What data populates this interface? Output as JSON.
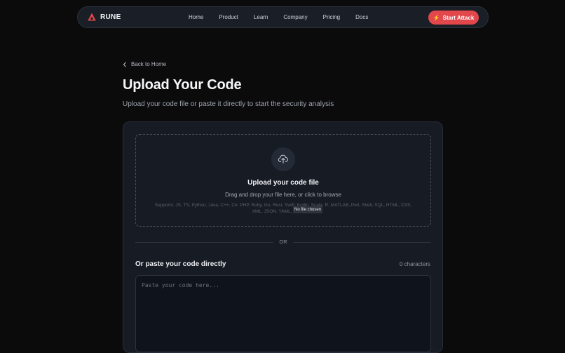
{
  "brand": {
    "name": "RUNE",
    "logo_icon": "triangle-logo-icon",
    "accent": "#e2474b"
  },
  "nav": {
    "links": [
      "Home",
      "Product",
      "Learn",
      "Company",
      "Pricing",
      "Docs"
    ],
    "cta_label": "Start Attack",
    "cta_icon": "lightning-icon"
  },
  "page": {
    "back_label": "Back to Home",
    "title": "Upload Your Code",
    "subtitle": "Upload your code file or paste it directly to start the security analysis"
  },
  "upload": {
    "icon": "cloud-upload-icon",
    "title": "Upload your code file",
    "description": "Drag and drop your file here, or click to browse",
    "supports": "Supports: JS, TS, Python, Java, C++, C#, PHP, Ruby, Go, Rust, Swift, Kotlin, Scala, R, MATLAB, Perl, Shell, SQL, HTML, CSS, XML, JSON, YAML, Markdown",
    "file_status": "No file chosen"
  },
  "divider_label": "OR",
  "paste": {
    "label": "Or paste your code directly",
    "char_count": "0 characters",
    "placeholder": "Paste your code here..."
  }
}
